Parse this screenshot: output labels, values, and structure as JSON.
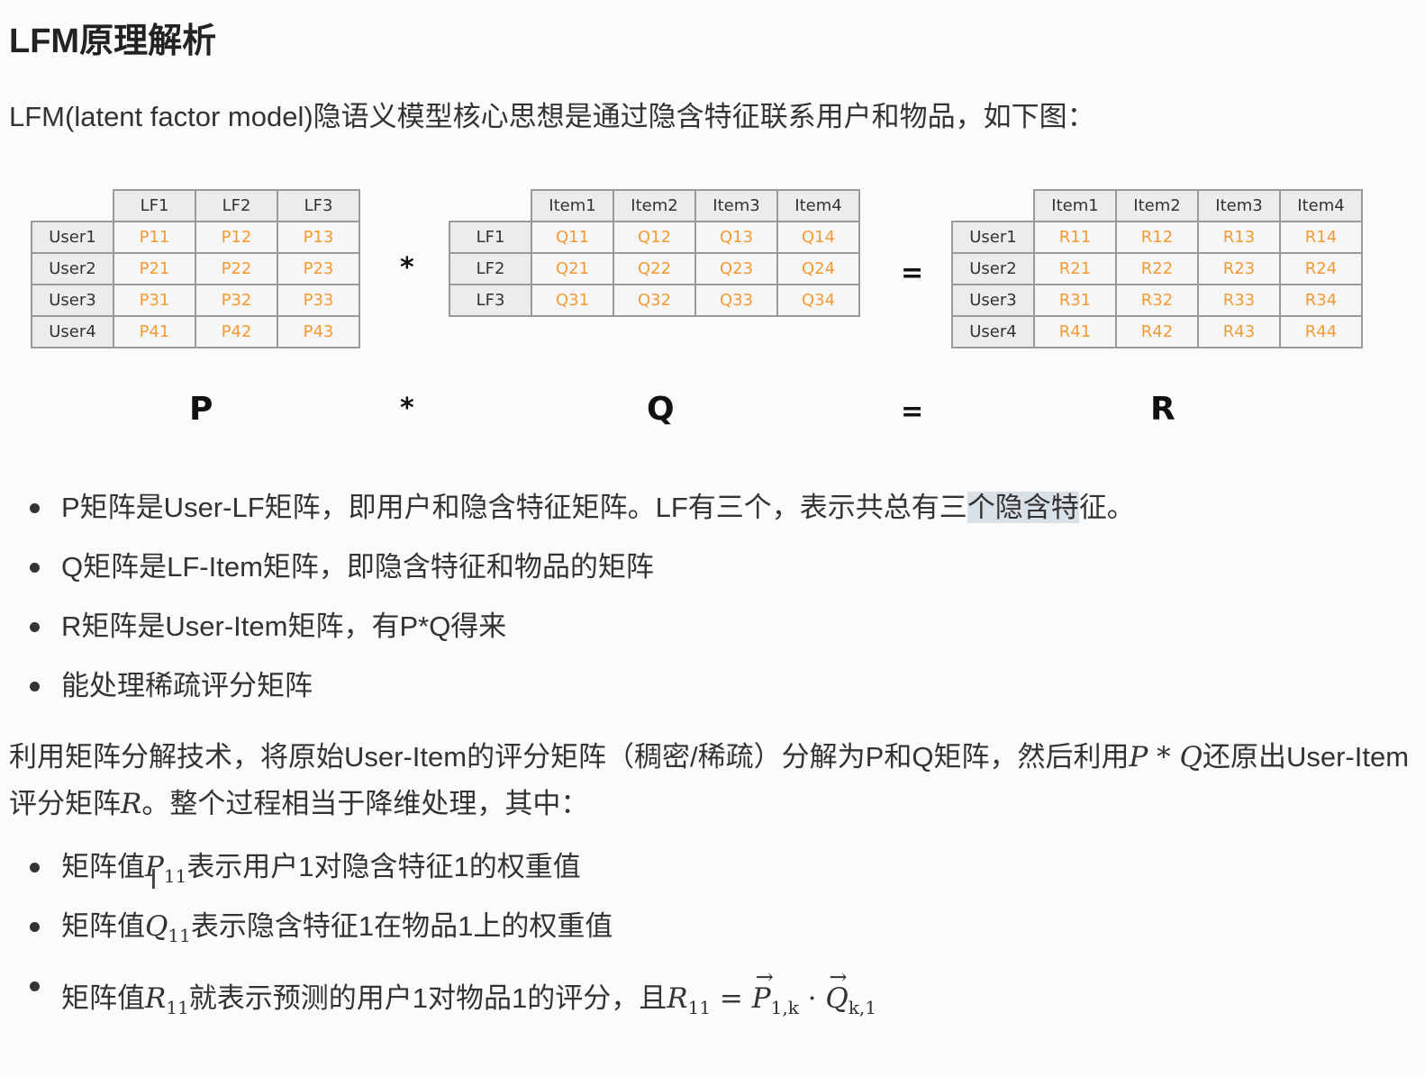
{
  "title": "LFM原理解析",
  "intro": "LFM(latent factor model)隐语义模型核心思想是通过隐含特征联系用户和物品，如下图：",
  "matrices": {
    "p": {
      "columns": [
        "LF1",
        "LF2",
        "LF3"
      ],
      "rows": [
        {
          "label": "User1",
          "cells": [
            "P11",
            "P12",
            "P13"
          ]
        },
        {
          "label": "User2",
          "cells": [
            "P21",
            "P22",
            "P23"
          ]
        },
        {
          "label": "User3",
          "cells": [
            "P31",
            "P32",
            "P33"
          ]
        },
        {
          "label": "User4",
          "cells": [
            "P41",
            "P42",
            "P43"
          ]
        }
      ]
    },
    "q": {
      "columns": [
        "Item1",
        "Item2",
        "Item3",
        "Item4"
      ],
      "rows": [
        {
          "label": "LF1",
          "cells": [
            "Q11",
            "Q12",
            "Q13",
            "Q14"
          ]
        },
        {
          "label": "LF2",
          "cells": [
            "Q21",
            "Q22",
            "Q23",
            "Q24"
          ]
        },
        {
          "label": "LF3",
          "cells": [
            "Q31",
            "Q32",
            "Q33",
            "Q34"
          ]
        }
      ]
    },
    "r": {
      "columns": [
        "Item1",
        "Item2",
        "Item3",
        "Item4"
      ],
      "rows": [
        {
          "label": "User1",
          "cells": [
            "R11",
            "R12",
            "R13",
            "R14"
          ]
        },
        {
          "label": "User2",
          "cells": [
            "R21",
            "R22",
            "R23",
            "R24"
          ]
        },
        {
          "label": "User3",
          "cells": [
            "R31",
            "R32",
            "R33",
            "R34"
          ]
        },
        {
          "label": "User4",
          "cells": [
            "R41",
            "R42",
            "R43",
            "R44"
          ]
        }
      ]
    }
  },
  "operators": {
    "times": "*",
    "equals": "="
  },
  "letters": {
    "p": "P",
    "q": "Q",
    "r": "R"
  },
  "bullets1": {
    "b1_before": "P矩阵是User-LF矩阵，即用户和隐含特征矩阵。LF有三个，表示共总有三",
    "b1_highlight": "个隐含特",
    "b1_after": "征。",
    "b2": "Q矩阵是LF-Item矩阵，即隐含特征和物品的矩阵",
    "b3": "R矩阵是User-Item矩阵，有P*Q得来",
    "b4": "能处理稀疏评分矩阵"
  },
  "paragraph": {
    "part1": "利用矩阵分解技术，将原始User-Item的评分矩阵（稠密/稀疏）分解为P和Q矩阵，然后利用",
    "math1": "P * Q",
    "part2": "还原出User-Item评分矩阵",
    "math2": "R",
    "part3": "。整个过程相当于降维处理，其中："
  },
  "bullets2": {
    "b1_pre": "矩阵值",
    "b1_var": "P",
    "b1_sub": "11",
    "b1_post": "表示用户1对隐含特征1的权重值",
    "b2_pre": "矩阵值",
    "b2_var": "Q",
    "b2_sub": "11",
    "b2_post": "表示隐含特征1在物品1上的权重值",
    "b3_pre": "矩阵值",
    "b3_var": "R",
    "b3_sub": "11",
    "b3_post": "就表示预测的用户1对物品1的评分，且",
    "b3_eq_var": "R",
    "b3_eq_sub": "11",
    "b3_eq": " = ",
    "b3_p": "P",
    "b3_p_sub": "1,k",
    "b3_dot": " · ",
    "b3_q": "Q",
    "b3_q_sub": "k,1"
  }
}
